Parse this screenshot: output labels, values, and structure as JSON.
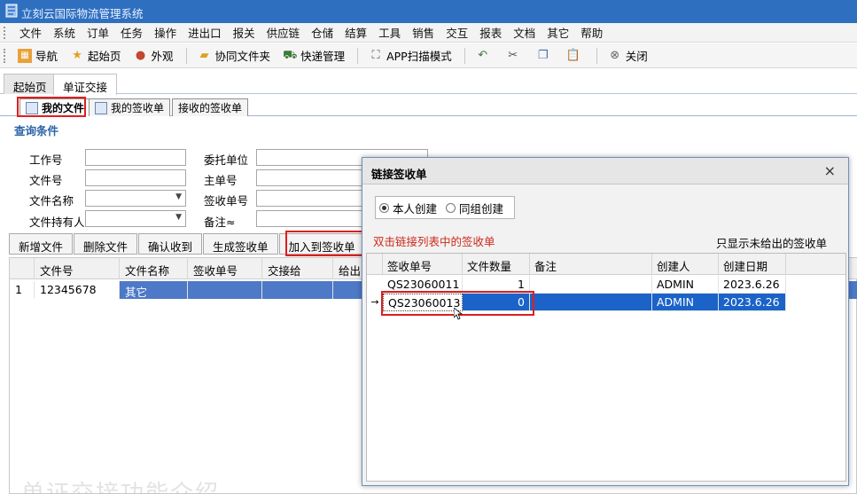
{
  "app": {
    "title": "立刻云国际物流管理系统"
  },
  "menu": [
    "文件",
    "系统",
    "订单",
    "任务",
    "操作",
    "进出口",
    "报关",
    "供应链",
    "仓储",
    "结算",
    "工具",
    "销售",
    "交互",
    "报表",
    "文档",
    "其它",
    "帮助"
  ],
  "toolbar": {
    "nav": "导航",
    "home": "起始页",
    "skin": "外观",
    "shared_folder": "协同文件夹",
    "express": "快递管理",
    "app_scan": "APP扫描模式",
    "close": "关闭"
  },
  "top_tabs": [
    "起始页",
    "单证交接"
  ],
  "sub_tabs": [
    "我的文件",
    "我的签收单",
    "接收的签收单"
  ],
  "query": {
    "title": "查询条件",
    "job_no": "工作号",
    "client": "委托单位",
    "file_no": "文件号",
    "master_no": "主单号",
    "file_name": "文件名称",
    "sign_no": "签收单号",
    "holder": "文件持有人",
    "remark": "备注≈"
  },
  "actions": [
    "新增文件",
    "删除文件",
    "确认收到",
    "生成签收单",
    "加入到签收单"
  ],
  "main_grid": {
    "headers": [
      "文件号",
      "文件名称",
      "签收单号",
      "交接给",
      "给出日"
    ],
    "rows": [
      {
        "idx": "1",
        "file_no": "12345678",
        "file_name": "其它"
      }
    ]
  },
  "watermark": "单证交接功能介绍",
  "dialog": {
    "title": "链接签收单",
    "close": "×",
    "radio_self": "本人创建",
    "radio_group": "同组创建",
    "hint": "双击链接列表中的签收单",
    "filter": "只显示未给出的签收单",
    "headers": [
      "签收单号",
      "文件数量",
      "备注",
      "创建人",
      "创建日期"
    ],
    "rows": [
      {
        "no": "QS23060011",
        "count": "1",
        "remark": "",
        "creator": "ADMIN",
        "date": "2023.6.26"
      },
      {
        "no": "QS23060013",
        "count": "0",
        "remark": "",
        "creator": "ADMIN",
        "date": "2023.6.26"
      }
    ],
    "row_marker": "→"
  },
  "colors": {
    "titlebar": "#2f6fc0",
    "selection": "#1b63c9",
    "highlight_box": "#e01e1e"
  }
}
